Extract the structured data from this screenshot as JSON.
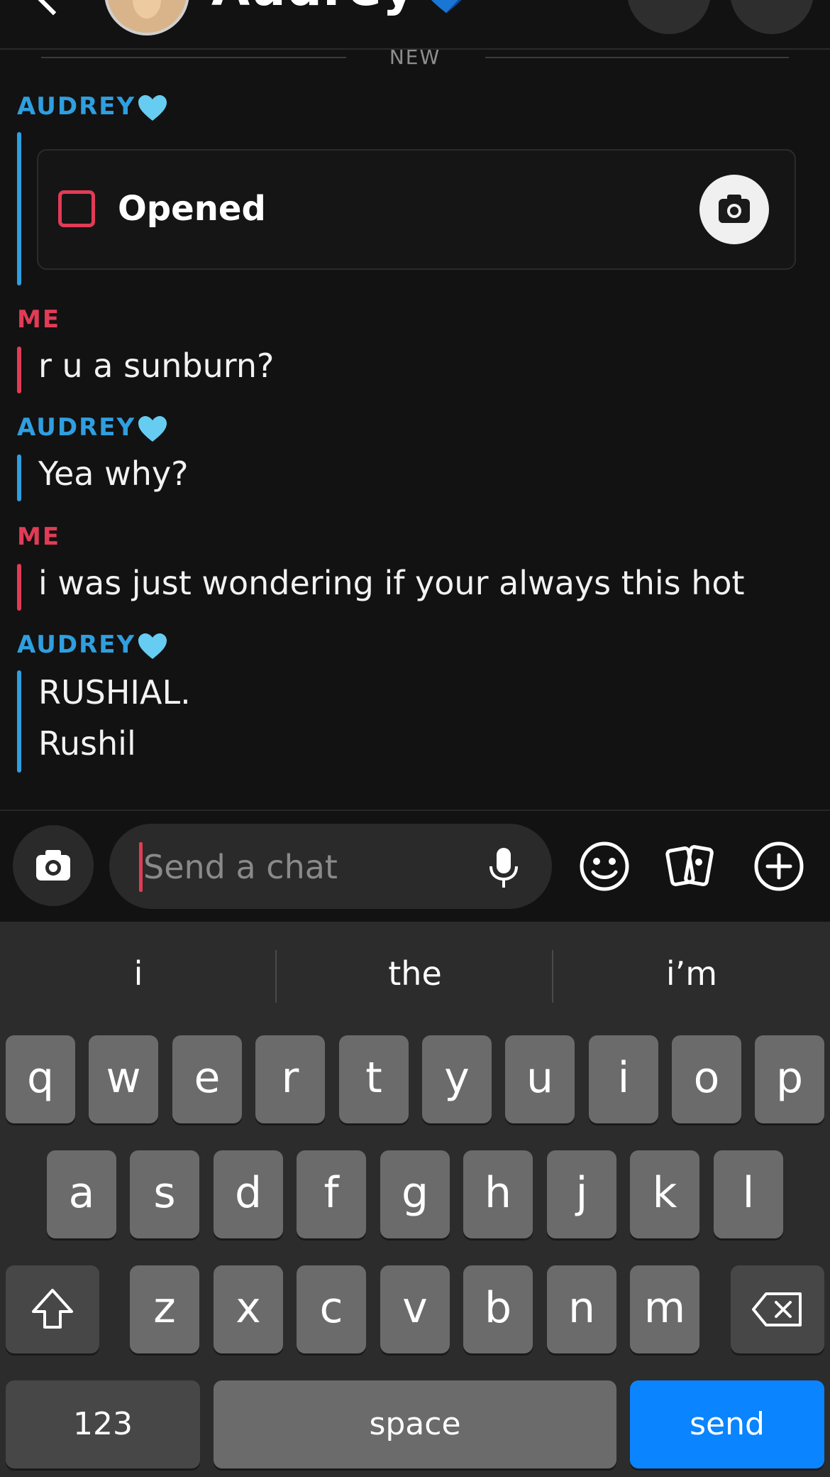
{
  "header": {
    "contact_name": "Audrey💙"
  },
  "divider": {
    "label": "NEW"
  },
  "messages": [
    {
      "sender": "AUDREY",
      "type": "snap",
      "status": "Opened"
    },
    {
      "sender": "ME",
      "text": "r u a sunburn?"
    },
    {
      "sender": "AUDREY",
      "text": "Yea why?"
    },
    {
      "sender": "ME",
      "text": "i was just wondering if your always this hot"
    },
    {
      "sender": "AUDREY",
      "lines": [
        "RUSHIAL.",
        "Rushil"
      ]
    }
  ],
  "compose": {
    "placeholder": "Send a chat"
  },
  "keyboard": {
    "suggestions": [
      "i",
      "the",
      "i’m"
    ],
    "row1": [
      "q",
      "w",
      "e",
      "r",
      "t",
      "y",
      "u",
      "i",
      "o",
      "p"
    ],
    "row2": [
      "a",
      "s",
      "d",
      "f",
      "g",
      "h",
      "j",
      "k",
      "l"
    ],
    "row3": [
      "z",
      "x",
      "c",
      "v",
      "b",
      "n",
      "m"
    ],
    "numbers_label": "123",
    "space_label": "space",
    "send_label": "send"
  },
  "colors": {
    "her_accent": "#2f9fe0",
    "me_accent": "#e23b56",
    "send_key": "#0a84ff"
  },
  "icons": [
    "back-chevron-icon",
    "phone-icon",
    "video-icon",
    "camera-icon",
    "microphone-icon",
    "smiley-icon",
    "cards-icon",
    "plus-circle-icon",
    "shift-icon",
    "backspace-icon",
    "heart-icon"
  ]
}
